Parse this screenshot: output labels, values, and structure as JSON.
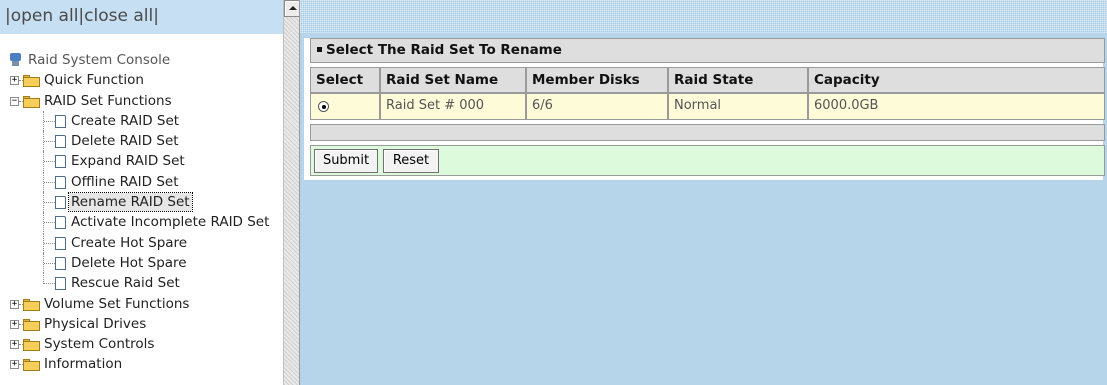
{
  "tree_header": {
    "open_all": "|open all",
    "close_all": "|close all|"
  },
  "tree": {
    "root": "Raid System Console",
    "quick_function": "Quick Function",
    "raid_set_functions": "RAID Set Functions",
    "raid_items": [
      "Create RAID Set",
      "Delete RAID Set",
      "Expand RAID Set",
      "Offline RAID Set",
      "Rename RAID Set",
      "Activate Incomplete RAID Set",
      "Create Hot Spare",
      "Delete Hot Spare",
      "Rescue Raid Set"
    ],
    "selected_item": "Rename RAID Set",
    "volume_set_functions": "Volume Set Functions",
    "physical_drives": "Physical Drives",
    "system_controls": "System Controls",
    "information": "Information",
    "expander_plus": "+",
    "expander_minus": "−"
  },
  "form": {
    "title": "Select The Raid Set To Rename",
    "columns": [
      "Select",
      "Raid Set Name",
      "Member Disks",
      "Raid State",
      "Capacity"
    ],
    "rows": [
      {
        "selected": true,
        "name": "Raid Set # 000",
        "member_disks": "6/6",
        "state": "Normal",
        "capacity": "6000.0GB"
      }
    ],
    "submit_label": "Submit",
    "reset_label": "Reset"
  },
  "colors": {
    "frame_background": "#b6d5ea",
    "header_cell": "#dedede",
    "data_row": "#fdfbd8",
    "button_row": "#ddfadd",
    "folder": "#f6cf5a"
  }
}
